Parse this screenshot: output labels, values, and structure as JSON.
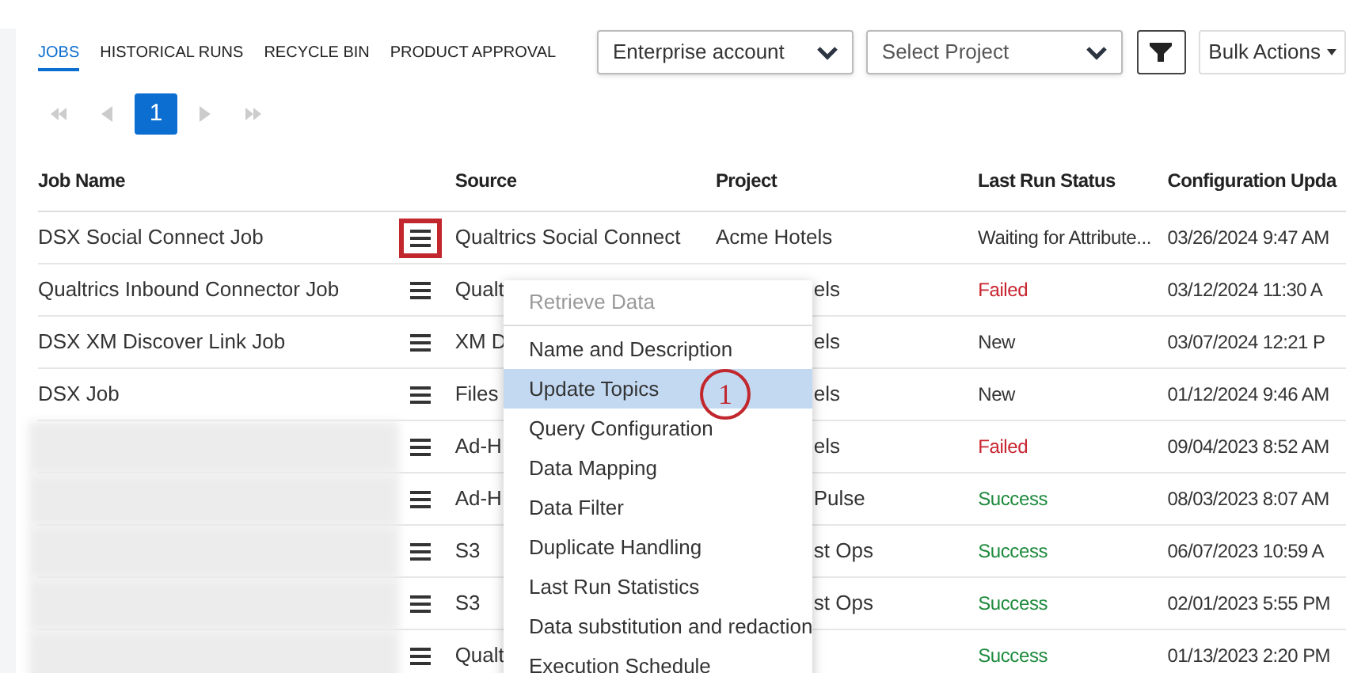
{
  "tabs": [
    {
      "label": "JOBS",
      "selected": true
    },
    {
      "label": "HISTORICAL RUNS",
      "selected": false
    },
    {
      "label": "RECYCLE BIN",
      "selected": false
    },
    {
      "label": "PRODUCT APPROVAL",
      "selected": false
    }
  ],
  "account_select": {
    "value": "Enterprise account"
  },
  "project_select": {
    "placeholder": "Select Project"
  },
  "bulk_actions": {
    "label": "Bulk Actions"
  },
  "pagination": {
    "pages": [
      {
        "label": "1",
        "selected": true
      }
    ]
  },
  "table": {
    "columns": [
      "Job Name",
      "Source",
      "Project",
      "Last Run Status",
      "Configuration Upda"
    ],
    "rows": [
      {
        "job_name": "DSX Social Connect Job",
        "blurred": false,
        "menu_highlighted": true,
        "source": "Qualtrics Social Connect",
        "project": "Acme Hotels",
        "status": "Waiting for Attribute...",
        "kind": "waiting",
        "date": "03/26/2024 9:47 AM"
      },
      {
        "job_name": "Qualtrics Inbound Connector Job",
        "blurred": false,
        "menu_highlighted": false,
        "source": "Qualt",
        "project": "els",
        "status": "Failed",
        "kind": "failed",
        "date": "03/12/2024 11:30 A"
      },
      {
        "job_name": "DSX XM Discover Link Job",
        "blurred": false,
        "menu_highlighted": false,
        "source": "XM D",
        "project": "els",
        "status": "New",
        "kind": "new",
        "date": "03/07/2024 12:21 P"
      },
      {
        "job_name": "DSX Job",
        "blurred": false,
        "menu_highlighted": false,
        "source": "Files",
        "project": "els",
        "status": "New",
        "kind": "new",
        "date": "01/12/2024 9:46 AM"
      },
      {
        "blurred": true,
        "menu_highlighted": false,
        "source": "Ad-H",
        "project": "els",
        "status": "Failed",
        "kind": "failed",
        "date": "09/04/2023 8:52 AM"
      },
      {
        "blurred": true,
        "menu_highlighted": false,
        "source": "Ad-H",
        "project": "Pulse",
        "status": "Success",
        "kind": "success",
        "date": "08/03/2023 8:07 AM"
      },
      {
        "blurred": true,
        "menu_highlighted": false,
        "source": "S3",
        "project": "st Ops",
        "status": "Success",
        "kind": "success",
        "date": "06/07/2023 10:59 A"
      },
      {
        "blurred": true,
        "menu_highlighted": false,
        "source": "S3",
        "project": "st Ops",
        "status": "Success",
        "kind": "success",
        "date": "02/01/2023 5:55 PM"
      },
      {
        "blurred": true,
        "menu_highlighted": false,
        "source": "Qualt",
        "status": "Success",
        "kind": "success",
        "date": "01/13/2023 2:20 PM"
      }
    ]
  },
  "context_menu": {
    "items": [
      {
        "label": "Retrieve Data",
        "disabled": true,
        "selected": false
      },
      {
        "label": "Name and Description",
        "disabled": false,
        "selected": false
      },
      {
        "label": "Update Topics",
        "disabled": false,
        "selected": true
      },
      {
        "label": "Query Configuration",
        "disabled": false,
        "selected": false
      },
      {
        "label": "Data Mapping",
        "disabled": false,
        "selected": false
      },
      {
        "label": "Data Filter",
        "disabled": false,
        "selected": false
      },
      {
        "label": "Duplicate Handling",
        "disabled": false,
        "selected": false
      },
      {
        "label": "Last Run Statistics",
        "disabled": false,
        "selected": false
      },
      {
        "label": "Data substitution and redaction",
        "disabled": false,
        "selected": false
      },
      {
        "label": "Execution Schedule",
        "disabled": false,
        "selected": false
      }
    ]
  },
  "callout": {
    "label": "1"
  }
}
